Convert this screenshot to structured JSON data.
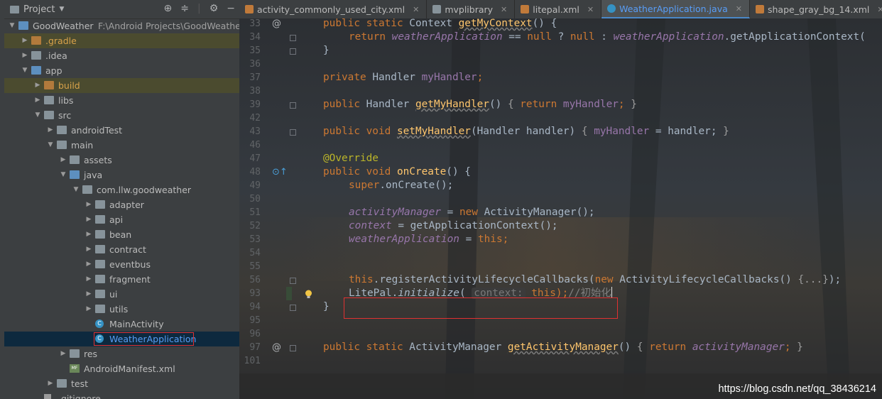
{
  "project_panel": {
    "title": "Project",
    "tree": [
      {
        "label": "GoodWeather",
        "path": "F:\\Android Projects\\GoodWeather",
        "depth": 0,
        "expanded": true,
        "icon": "module-folder-icon"
      },
      {
        "label": ".gradle",
        "depth": 1,
        "expanded": false,
        "icon": "folder-icon",
        "highlight": true
      },
      {
        "label": ".idea",
        "depth": 1,
        "expanded": false,
        "icon": "folder-icon"
      },
      {
        "label": "app",
        "depth": 1,
        "expanded": true,
        "icon": "module-folder-icon"
      },
      {
        "label": "build",
        "depth": 2,
        "expanded": false,
        "icon": "folder-icon",
        "highlight": true
      },
      {
        "label": "libs",
        "depth": 2,
        "expanded": false,
        "icon": "folder-icon"
      },
      {
        "label": "src",
        "depth": 2,
        "expanded": true,
        "icon": "folder-icon"
      },
      {
        "label": "androidTest",
        "depth": 3,
        "expanded": false,
        "icon": "folder-icon"
      },
      {
        "label": "main",
        "depth": 3,
        "expanded": true,
        "icon": "folder-icon"
      },
      {
        "label": "assets",
        "depth": 4,
        "expanded": false,
        "icon": "folder-icon"
      },
      {
        "label": "java",
        "depth": 4,
        "expanded": true,
        "icon": "source-folder-icon"
      },
      {
        "label": "com.llw.goodweather",
        "depth": 5,
        "expanded": true,
        "icon": "package-icon"
      },
      {
        "label": "adapter",
        "depth": 6,
        "expanded": false,
        "icon": "package-icon"
      },
      {
        "label": "api",
        "depth": 6,
        "expanded": false,
        "icon": "package-icon"
      },
      {
        "label": "bean",
        "depth": 6,
        "expanded": false,
        "icon": "package-icon"
      },
      {
        "label": "contract",
        "depth": 6,
        "expanded": false,
        "icon": "package-icon"
      },
      {
        "label": "eventbus",
        "depth": 6,
        "expanded": false,
        "icon": "package-icon"
      },
      {
        "label": "fragment",
        "depth": 6,
        "expanded": false,
        "icon": "package-icon"
      },
      {
        "label": "ui",
        "depth": 6,
        "expanded": false,
        "icon": "package-icon"
      },
      {
        "label": "utils",
        "depth": 6,
        "expanded": false,
        "icon": "package-icon"
      },
      {
        "label": "MainActivity",
        "depth": 6,
        "icon": "class-icon"
      },
      {
        "label": "WeatherApplication",
        "depth": 6,
        "icon": "class-icon",
        "selected": true
      },
      {
        "label": "res",
        "depth": 4,
        "expanded": false,
        "icon": "resource-folder-icon"
      },
      {
        "label": "AndroidManifest.xml",
        "depth": 4,
        "icon": "manifest-icon"
      },
      {
        "label": "test",
        "depth": 3,
        "expanded": false,
        "icon": "folder-icon"
      },
      {
        "label": ".gitignore",
        "depth": 2,
        "icon": "file-icon"
      }
    ]
  },
  "tabs": [
    {
      "label": "activity_commonly_used_city.xml",
      "icon": "xml-file-icon",
      "active": false
    },
    {
      "label": "mvplibrary",
      "icon": "module-icon",
      "active": false
    },
    {
      "label": "litepal.xml",
      "icon": "xml-file-icon",
      "active": false
    },
    {
      "label": "WeatherApplication.java",
      "icon": "class-icon",
      "active": true
    },
    {
      "label": "shape_gray_bg_14.xml",
      "icon": "xml-file-icon",
      "active": false
    }
  ],
  "editor": {
    "line_numbers": [
      "33",
      "34",
      "35",
      "36",
      "37",
      "38",
      "39",
      "42",
      "43",
      "46",
      "47",
      "48",
      "49",
      "50",
      "51",
      "52",
      "53",
      "54",
      "55",
      "56",
      "93",
      "94",
      "95",
      "96",
      "97",
      "101"
    ],
    "code": {
      "l33": [
        "public static ",
        "Context ",
        "getMyContext",
        "() {"
      ],
      "l34": [
        "return ",
        "weatherApplication",
        " == ",
        "null",
        " ? ",
        "null",
        " : ",
        "weatherApplication",
        ".getApplicationContext("
      ],
      "l35": [
        "}"
      ],
      "l37": [
        "private ",
        "Handler ",
        "myHandler",
        ";"
      ],
      "l39": [
        "public ",
        "Handler ",
        "getMyHandler",
        "() ",
        "{ ",
        "return ",
        "myHandler",
        "; ",
        "}"
      ],
      "l43": [
        "public void ",
        "setMyHandler",
        "(Handler handler) ",
        "{ ",
        "myHandler",
        " = handler; ",
        "}"
      ],
      "l47": [
        "@Override"
      ],
      "l48": [
        "public void ",
        "onCreate",
        "() {"
      ],
      "l49": [
        "super",
        ".onCreate();"
      ],
      "l51": [
        "activityManager",
        " = ",
        "new ",
        "ActivityManager();"
      ],
      "l52": [
        "context",
        " = getApplicationContext();"
      ],
      "l53": [
        "weatherApplication",
        " = ",
        "this",
        ";"
      ],
      "l56": [
        "this",
        ".registerActivityLifecycleCallbacks(",
        "new ",
        "ActivityLifecycleCallbacks() ",
        "{...}",
        ");"
      ],
      "l93": [
        "LitePal.",
        "initialize",
        "( ",
        "context:",
        " this",
        ");",
        "//初始化"
      ],
      "l94": [
        "}"
      ],
      "l97": [
        "public static ",
        "ActivityManager ",
        "getActivityManager",
        "() ",
        "{ ",
        "return ",
        "activityManager",
        "; ",
        "}"
      ]
    }
  },
  "watermark": "https://blog.csdn.net/qq_38436214"
}
